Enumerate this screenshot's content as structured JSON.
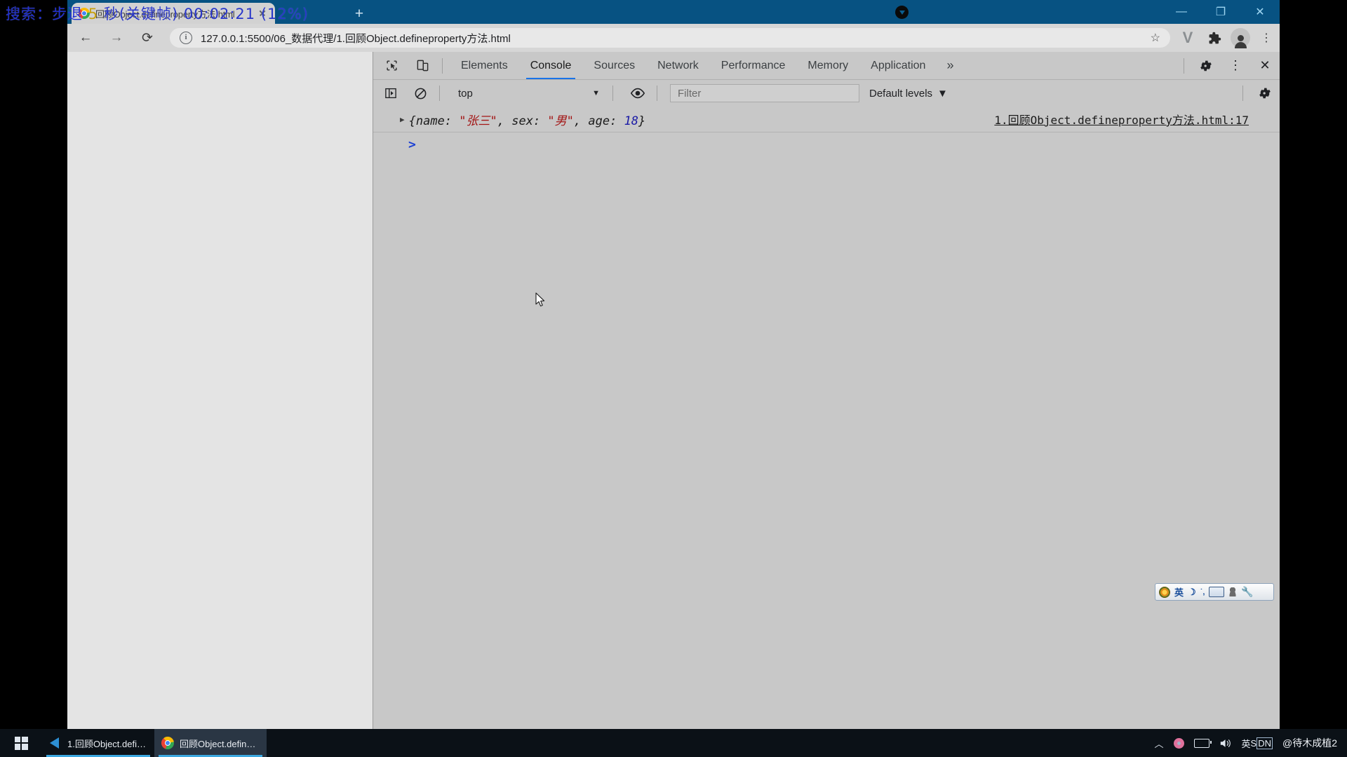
{
  "recorder_overlay": {
    "prefix": "搜索：步退",
    "seconds": "5",
    "suffix": "秒(关键帧)",
    "timecode": "00:02:21",
    "percent": "(12%)"
  },
  "browser": {
    "tab": {
      "title": "回顾Object.defineproperty方法.html",
      "favicon": "chrome-favicon",
      "close_icon": "close-icon"
    },
    "new_tab_label": "+",
    "window_controls": {
      "minimize": "—",
      "maximize": "❐",
      "close": "✕"
    },
    "nav": {
      "back": "←",
      "forward": "→",
      "reload": "⟳"
    },
    "omnibox": {
      "info_icon": "info-icon",
      "url": "127.0.0.1:5500/06_数据代理/1.回顾Object.defineproperty方法.html",
      "star_icon": "star-icon"
    },
    "toolbar_icons": {
      "vimium": "V",
      "extensions": "puzzle-icon",
      "profile": "profile-avatar-icon",
      "menu": "⋮"
    }
  },
  "devtools": {
    "tools": {
      "inspect_icon": "inspect-element-icon",
      "device_toggle_icon": "device-toolbar-icon"
    },
    "tabs": [
      {
        "label": "Elements",
        "active": false
      },
      {
        "label": "Console",
        "active": true
      },
      {
        "label": "Sources",
        "active": false
      },
      {
        "label": "Network",
        "active": false
      },
      {
        "label": "Performance",
        "active": false
      },
      {
        "label": "Memory",
        "active": false
      },
      {
        "label": "Application",
        "active": false
      }
    ],
    "more_tabs": "»",
    "settings_icon": "gear-icon",
    "kebab_icon": "⋮",
    "close_icon": "✕",
    "console_toolbar": {
      "sidebar_icon": "console-sidebar-icon",
      "clear_icon": "clear-console-icon",
      "context": "top",
      "context_caret": "▼",
      "eye_icon": "live-expression-icon",
      "filter_placeholder": "Filter",
      "filter_value": "",
      "levels": "Default levels",
      "levels_caret": "▼",
      "settings_icon": "gear-icon"
    },
    "console_log": {
      "expander": "▶",
      "prefix": "{name: ",
      "name_value": "\"张三\"",
      "mid1": ", sex: ",
      "sex_value": "\"男\"",
      "mid2": ", age: ",
      "age_value": "18",
      "suffix": "}",
      "source": "1.回顾Object.defineproperty方法.html:17"
    },
    "prompt_caret": ">"
  },
  "ime_bar": {
    "logo": "sogou-logo-icon",
    "mode": "英",
    "moon_icon": "moon-icon",
    "punct_icon": "punctuation-icon",
    "keyboard_icon": "keyboard-icon",
    "user_icon": "user-icon",
    "wrench_icon": "wrench-icon"
  },
  "taskbar": {
    "start_icon": "windows-start-icon",
    "items": [
      {
        "label": "1.回顾Object.define...",
        "icon": "vscode-icon",
        "active": false
      },
      {
        "label": "回顾Object.definepr...",
        "icon": "chrome-icon",
        "active": true
      }
    ],
    "tray": {
      "chevron": "︿",
      "flower_icon": "flower-icon",
      "battery_icon": "battery-icon",
      "volume_icon": "volume-icon",
      "ime_lang": "英",
      "ime_s": "S",
      "ime_dn": "DN",
      "user": "@待木成植2"
    }
  },
  "colors": {
    "titlebar": "#075282",
    "devtools_bg": "#c8c8c8",
    "active_tab_underline": "#1a73e8",
    "string_value": "#a31515",
    "number_value": "#1a1aa6",
    "taskbar": "#0b1117",
    "overlay_text": "#1f2fd0"
  }
}
